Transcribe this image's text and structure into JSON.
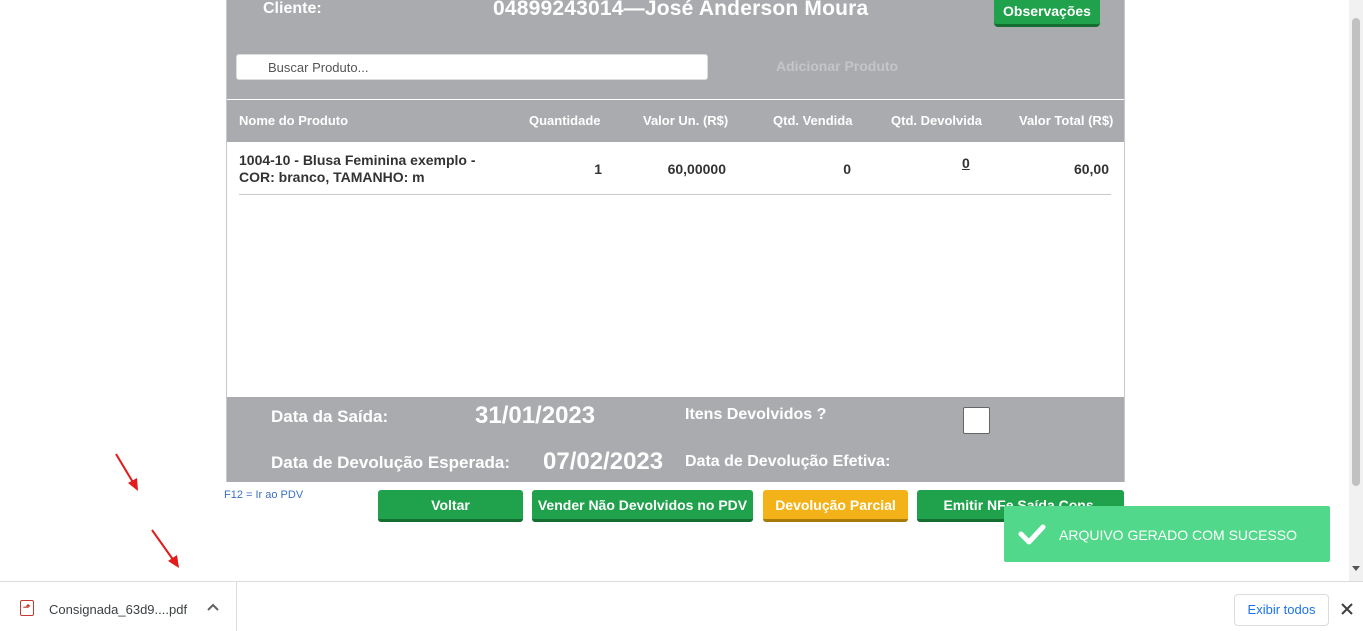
{
  "header": {
    "cliente_label": "Cliente:",
    "cliente_name": "04899243014—José Anderson Moura",
    "observacoes_label": "Observações"
  },
  "search": {
    "placeholder": "Buscar Produto...",
    "add_label": "Adicionar Produto"
  },
  "table": {
    "columns": [
      "Nome do Produto",
      "Quantidade",
      "Valor Un. (R$)",
      "Qtd. Vendida",
      "Qtd. Devolvida",
      "Valor Total (R$)"
    ],
    "rows": [
      {
        "name": "1004-10 - Blusa Feminina exemplo - COR: branco, TAMANHO: m",
        "quantidade": "1",
        "valor_un": "60,00000",
        "qtd_vendida": "0",
        "qtd_devolvida": "0",
        "valor_total": "60,00"
      }
    ]
  },
  "footer": {
    "data_saida_label": "Data da Saída:",
    "data_saida": "31/01/2023",
    "itens_devolvidos_label": "Itens Devolvidos ?",
    "data_devolucao_esperada_label": "Data de Devolução Esperada:",
    "data_devolucao_esperada": "07/02/2023",
    "data_devolucao_efetiva_label": "Data de Devolução Efetiva:"
  },
  "shortcut_hint": "F12 = Ir ao PDV",
  "actions": {
    "voltar": "Voltar",
    "vender": "Vender Não Devolvidos no PDV",
    "devolucao_parcial": "Devolução Parcial",
    "emitir_nfe": "Emitir NFe Saída Cons."
  },
  "toast": {
    "message": "ARQUIVO GERADO COM SUCESSO",
    "icon": "check-icon"
  },
  "download_bar": {
    "file_name": "Consignada_63d9....pdf",
    "file_icon": "pdf-file-icon",
    "show_all_label": "Exibir todos"
  },
  "colors": {
    "header_gray": "#aaabae",
    "green": "#1fa24b",
    "yellow": "#f3b318",
    "toast_green": "#51d88a",
    "annotation_red": "#e21b1b"
  }
}
